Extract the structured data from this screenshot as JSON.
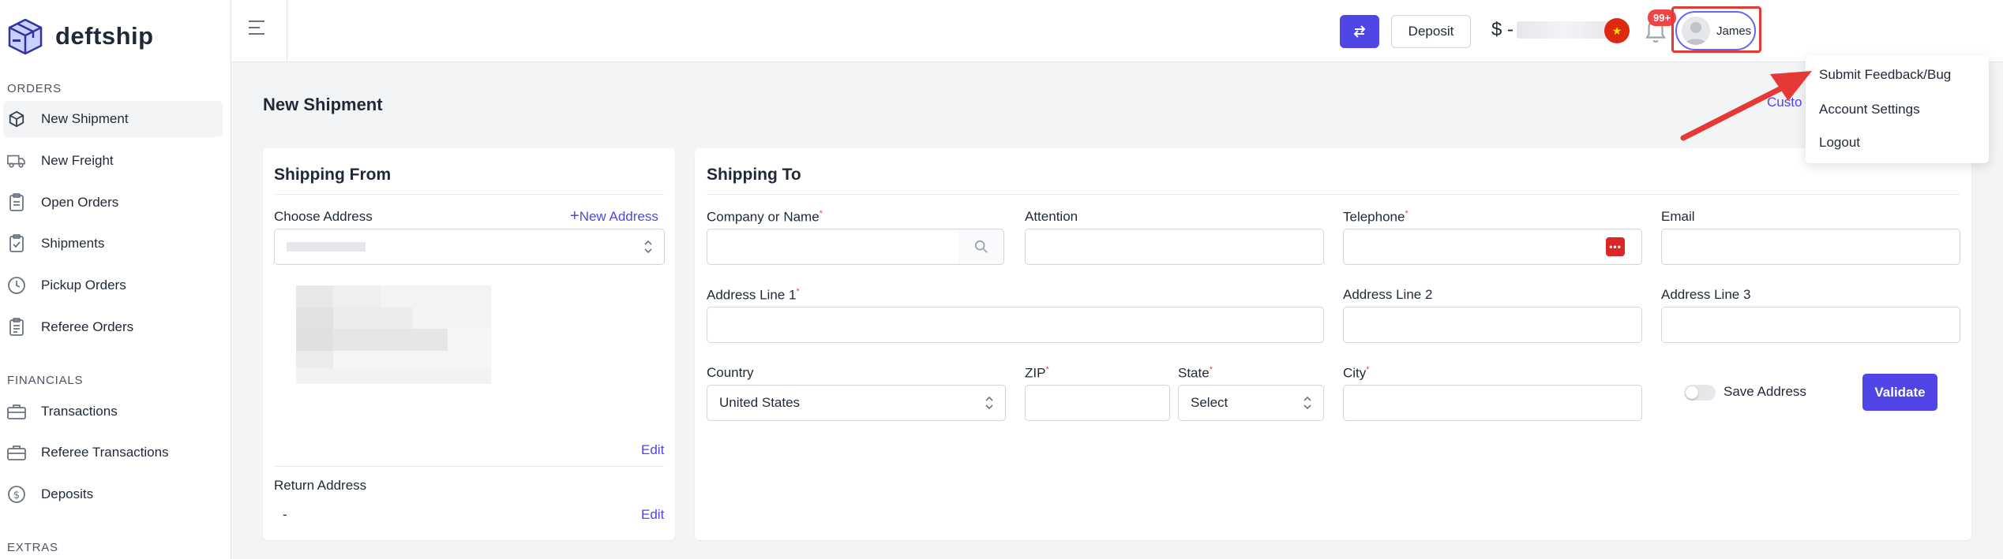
{
  "brand": {
    "name": "deftship"
  },
  "sidebar": {
    "sections": [
      {
        "label": "ORDERS"
      },
      {
        "label": "FINANCIALS"
      },
      {
        "label": "EXTRAS"
      }
    ],
    "items": [
      {
        "label": "New Shipment",
        "icon": "cube-icon"
      },
      {
        "label": "New Freight",
        "icon": "truck-icon"
      },
      {
        "label": "Open Orders",
        "icon": "clipboard-icon"
      },
      {
        "label": "Shipments",
        "icon": "clipboard-check-icon"
      },
      {
        "label": "Pickup Orders",
        "icon": "clock-icon"
      },
      {
        "label": "Referee Orders",
        "icon": "clipboard-list-icon"
      },
      {
        "label": "Transactions",
        "icon": "briefcase-icon"
      },
      {
        "label": "Referee Transactions",
        "icon": "briefcase-icon"
      },
      {
        "label": "Deposits",
        "icon": "dollar-circle-icon"
      }
    ]
  },
  "topbar": {
    "deposit_label": "Deposit",
    "balance_prefix": "$ -",
    "notification_badge": "99+",
    "user_name": "James",
    "accent_color": "#4f46e5"
  },
  "user_menu": {
    "items": [
      "Submit Feedback/Bug",
      "Account Settings",
      "Logout"
    ]
  },
  "page": {
    "title": "New Shipment",
    "customs_link": "Custo"
  },
  "shipping_from": {
    "title": "Shipping From",
    "choose_address_label": "Choose Address",
    "new_address_label": "New Address",
    "edit_label": "Edit",
    "return_address_label": "Return Address",
    "return_address_value": "-",
    "return_edit_label": "Edit"
  },
  "shipping_to": {
    "title": "Shipping To",
    "company_label": "Company or Name",
    "attention_label": "Attention",
    "telephone_label": "Telephone",
    "email_label": "Email",
    "address1_label": "Address Line 1",
    "address2_label": "Address Line 2",
    "address3_label": "Address Line 3",
    "country_label": "Country",
    "country_value": "United States",
    "zip_label": "ZIP",
    "state_label": "State",
    "state_value": "Select",
    "city_label": "City",
    "save_address_label": "Save Address",
    "validate_label": "Validate",
    "required_marker": "*"
  }
}
